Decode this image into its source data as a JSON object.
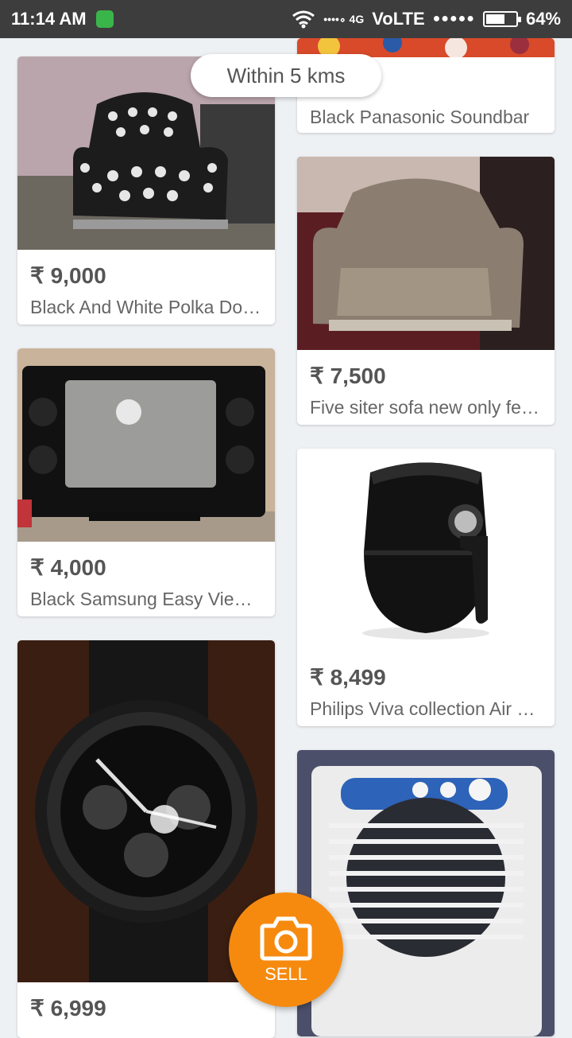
{
  "status_bar": {
    "time": "11:14 AM",
    "signal_text": "••••∘ 4G",
    "network": "VoLTE",
    "dots": "●●●●●",
    "battery": "64%",
    "battery_level": 0.64
  },
  "filter_pill": {
    "label": "Within 5 kms"
  },
  "listings": [
    {
      "price": "",
      "title": "Black Panasonic Soundbar"
    },
    {
      "price": "₹ 9,000",
      "title": "Black And White Polka Dot Sofa"
    },
    {
      "price": "₹ 7,500",
      "title": "Five siter sofa new only few days"
    },
    {
      "price": "₹ 4,000",
      "title": "Black Samsung Easy View TV"
    },
    {
      "price": "₹ 8,499",
      "title": "Philips Viva collection Air Fryer"
    },
    {
      "price": "₹ 6,999",
      "title": ""
    },
    {
      "price": "",
      "title": ""
    }
  ],
  "sell_button": {
    "label": "SELL"
  },
  "colors": {
    "accent": "#f68a0f",
    "status_bar": "#3d3d3d",
    "background": "#eef1f4"
  }
}
